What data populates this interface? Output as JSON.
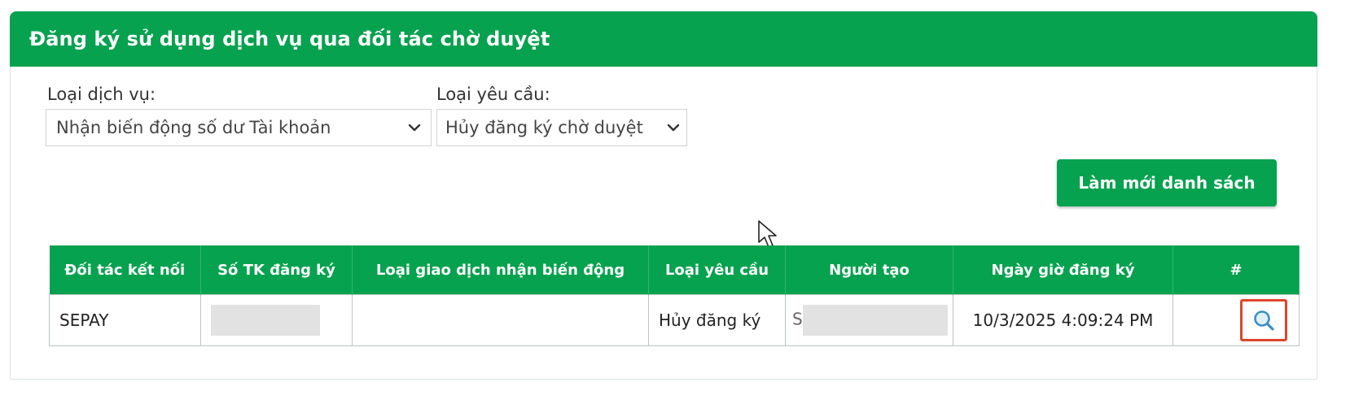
{
  "panel": {
    "title": "Đăng ký sử dụng dịch vụ qua đối tác chờ duyệt"
  },
  "filters": {
    "service_type": {
      "label": "Loại dịch vụ:",
      "value": "Nhận biến động số dư Tài khoản"
    },
    "request_type": {
      "label": "Loại yêu cầu:",
      "value": "Hủy đăng ký chờ duyệt"
    }
  },
  "actions": {
    "refresh_label": "Làm mới danh sách"
  },
  "table": {
    "headers": [
      "Đối tác kết nối",
      "Số TK đăng ký",
      "Loại giao dịch nhận biến động",
      "Loại yêu cầu",
      "Người tạo",
      "Ngày giờ đăng ký",
      "#"
    ],
    "rows": [
      {
        "partner": "SEPAY",
        "account_no": "",
        "txn_type": "",
        "request_type": "Hủy đăng ký",
        "creator_initial": "S",
        "created_at": "10/3/2025 4:09:24 PM",
        "action_icon": "search-icon"
      }
    ]
  },
  "colors": {
    "brand_green": "#07a24f",
    "highlight_red": "#e0452b"
  }
}
